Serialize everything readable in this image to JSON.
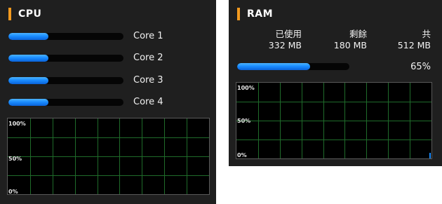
{
  "cpu": {
    "title": "CPU",
    "cores": [
      {
        "label": "Core 1",
        "usage": 0.35
      },
      {
        "label": "Core 2",
        "usage": 0.35
      },
      {
        "label": "Core 3",
        "usage": 0.35
      },
      {
        "label": "Core 4",
        "usage": 0.35
      }
    ],
    "graph": {
      "label_top": "100%",
      "label_mid": "50%",
      "label_bottom": "0%"
    }
  },
  "ram": {
    "title": "RAM",
    "used_label": "已使用",
    "used_value": "332 MB",
    "free_label": "剩餘",
    "free_value": "180 MB",
    "total_label": "共",
    "total_value": "512 MB",
    "percent_text": "65%",
    "usage": 0.65,
    "graph": {
      "label_top": "100%",
      "label_mid": "50%",
      "label_bottom": "0%"
    }
  },
  "colors": {
    "panel_bg": "#1f1f1f",
    "accent": "#f39a1f",
    "bar_blue": "#1a8cff",
    "grid_green": "#1f6b2a"
  }
}
